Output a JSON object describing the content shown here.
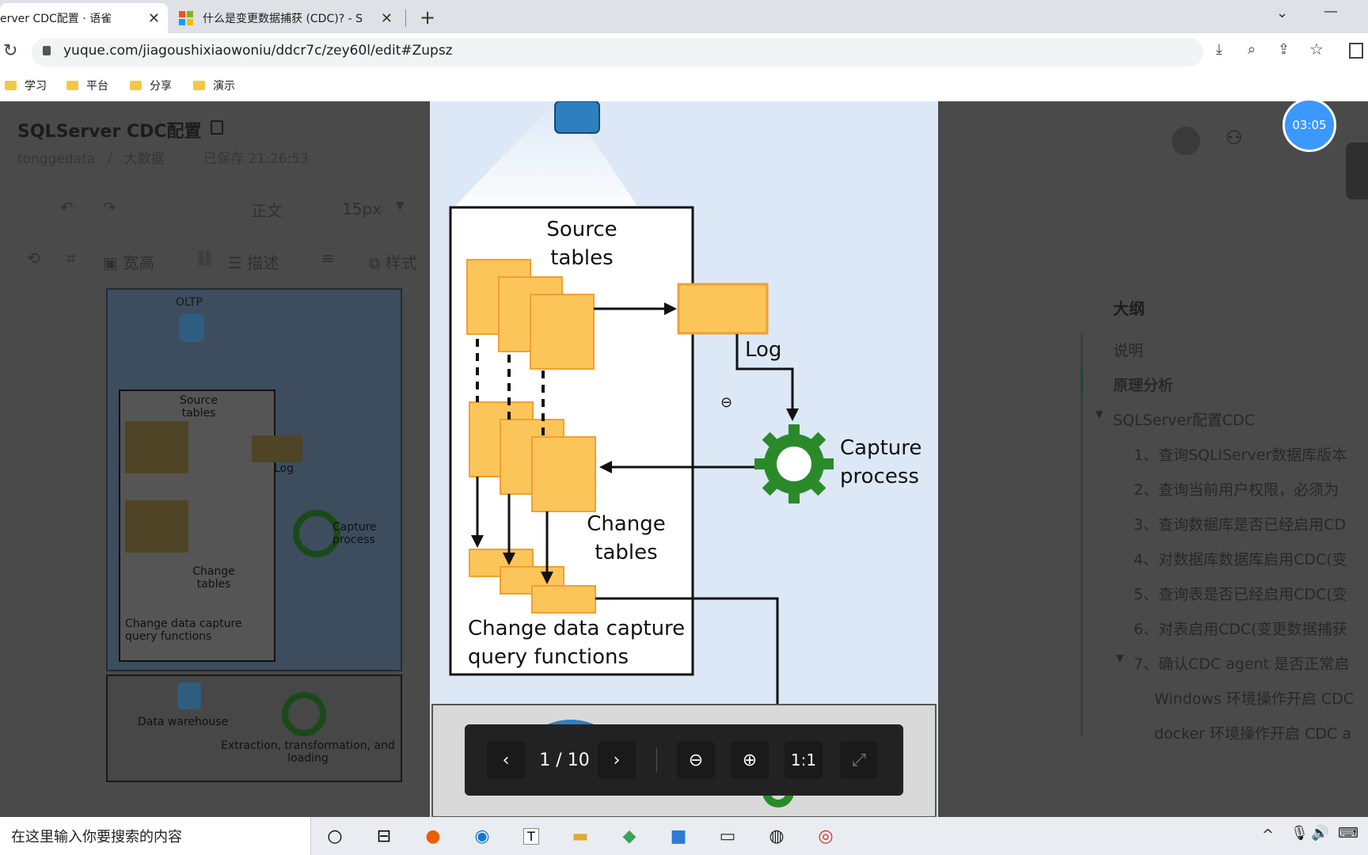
{
  "browser": {
    "tabs": [
      {
        "title": "erver CDC配置 · 语雀",
        "active": true
      },
      {
        "title": "什么是变更数据捕获 (CDC)?  - S",
        "active": false
      }
    ],
    "new_tab": "+",
    "url": "yuque.com/jiagoushixiaowoniu/ddcr7c/zey60l/edit#Zupsz",
    "bookmarks": [
      "学习",
      "平台",
      "分享",
      "演示"
    ]
  },
  "doc": {
    "title": "SQLServer CDC配置",
    "breadcrumb": [
      "tonggedata",
      "/",
      "大数据"
    ],
    "saved": "已保存 21:26:53",
    "font_size": "15px",
    "style_label": "正文",
    "image_toolbar": {
      "size": "宽高",
      "describe": "描述",
      "style": "样式"
    }
  },
  "thumbnail": {
    "oltp": "OLTP",
    "source_tables": "Source tables",
    "log": "Log",
    "capture": "Capture process",
    "change_tables": "Change tables",
    "query_fns": "Change data capture query functions",
    "warehouse": "Data warehouse",
    "etl": "Extraction, transformation, and loading"
  },
  "diagram": {
    "source_tables_1": "Source",
    "source_tables_2": "tables",
    "log": "Log",
    "capture_1": "Capture",
    "capture_2": "process",
    "change_1": "Change",
    "change_2": "tables",
    "query_1": "Change data capture",
    "query_2": "query functions"
  },
  "viewer": {
    "page": "1 / 10",
    "ratio": "1:1",
    "prev": "‹",
    "next": "›"
  },
  "timer": "03:05",
  "outline": {
    "title": "大纲",
    "items": [
      {
        "label": "说明",
        "level": 0
      },
      {
        "label": "原理分析",
        "level": 0,
        "active": true
      },
      {
        "label": "SQLServer配置CDC",
        "level": 0
      },
      {
        "label": "1、查询SQLlServer数据库版本",
        "level": 1
      },
      {
        "label": "2、查询当前用户权限，必须为",
        "level": 1
      },
      {
        "label": "3、查询数据库是否已经启用CD",
        "level": 1
      },
      {
        "label": "4、对数据库数据库启用CDC(变",
        "level": 1
      },
      {
        "label": "5、查询表是否已经启用CDC(变",
        "level": 1
      },
      {
        "label": "6、对表启用CDC(变更数据捕获",
        "level": 1
      },
      {
        "label": "7、确认CDC agent 是否正常启",
        "level": 1
      },
      {
        "label": "Windows 环境操作开启 CDC",
        "level": 2
      },
      {
        "label": "docker 环境操作开启 CDC a",
        "level": 2
      }
    ]
  },
  "taskbar": {
    "search_placeholder": "在这里输入你要搜索的内容"
  }
}
